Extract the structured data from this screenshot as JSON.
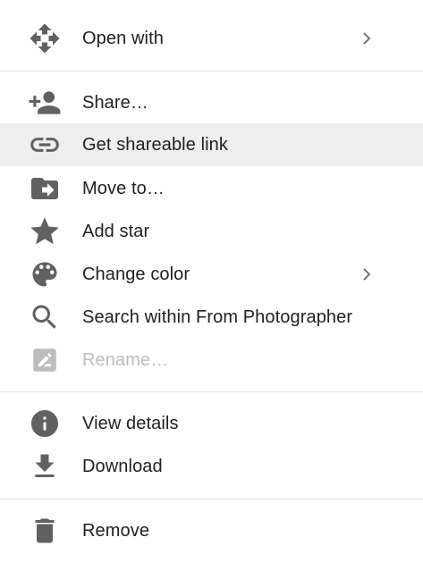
{
  "menu": {
    "items": [
      {
        "label": "Open with",
        "icon": "open-with-icon",
        "submenu": true
      },
      {
        "label": "Share…",
        "icon": "share-person-add-icon"
      },
      {
        "label": "Get shareable link",
        "icon": "link-icon",
        "highlighted": true
      },
      {
        "label": "Move to…",
        "icon": "move-to-folder-icon"
      },
      {
        "label": "Add star",
        "icon": "star-icon"
      },
      {
        "label": "Change color",
        "icon": "palette-icon",
        "submenu": true
      },
      {
        "label": "Search within From Photographer",
        "icon": "search-icon"
      },
      {
        "label": "Rename…",
        "icon": "rename-icon",
        "disabled": true
      },
      {
        "label": "View details",
        "icon": "info-icon"
      },
      {
        "label": "Download",
        "icon": "download-icon"
      },
      {
        "label": "Remove",
        "icon": "trash-icon"
      }
    ]
  },
  "colors": {
    "icon": "#616161",
    "icon_disabled": "#bdbdbd",
    "text": "#212121",
    "text_disabled": "#bdbdbd",
    "highlight_bg": "#eeeeee",
    "divider": "#e0e0e0"
  }
}
